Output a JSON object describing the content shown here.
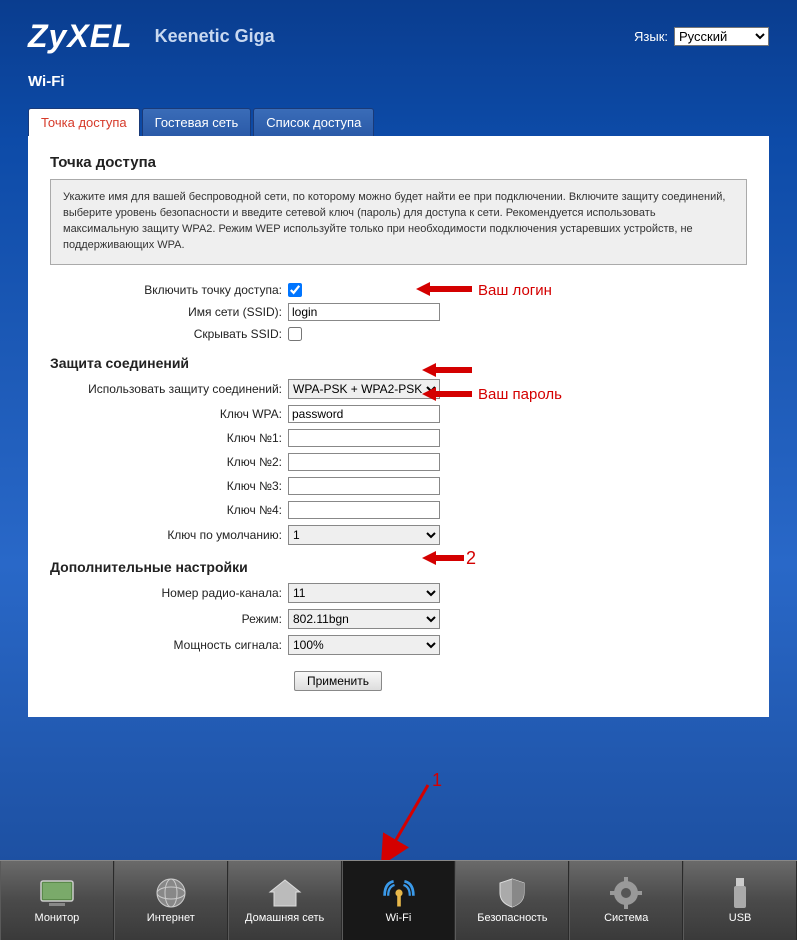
{
  "header": {
    "logo": "ZyXEL",
    "product": "Keenetic Giga",
    "lang_label": "Язык:",
    "lang_value": "Русский"
  },
  "page_title": "Wi-Fi",
  "tabs": [
    {
      "label": "Точка доступа",
      "active": true
    },
    {
      "label": "Гостевая сеть",
      "active": false
    },
    {
      "label": "Список доступа",
      "active": false
    }
  ],
  "main": {
    "heading": "Точка доступа",
    "help": "Укажите имя для вашей беспроводной сети, по которому можно будет найти ее при подключении. Включите защиту соединений, выберите уровень безопасности и введите сетевой ключ (пароль) для доступа к сети. Рекомендуется использовать максимальную защиту WPA2. Режим WEP используйте только при необходимости подключения устаревших устройств, не поддерживающих WPA."
  },
  "fields": {
    "enable_ap_label": "Включить точку доступа:",
    "ssid_label": "Имя сети (SSID):",
    "ssid_value": "login",
    "hide_ssid_label": "Скрывать SSID:"
  },
  "security": {
    "heading": "Защита соединений",
    "mode_label": "Использовать защиту соединений:",
    "mode_value": "WPA-PSK + WPA2-PSK",
    "wpa_key_label": "Ключ WPA:",
    "wpa_key_value": "password",
    "key1_label": "Ключ №1:",
    "key2_label": "Ключ №2:",
    "key3_label": "Ключ №3:",
    "key4_label": "Ключ №4:",
    "default_key_label": "Ключ по умолчанию:",
    "default_key_value": "1"
  },
  "advanced": {
    "heading": "Дополнительные настройки",
    "channel_label": "Номер радио-канала:",
    "channel_value": "11",
    "mode_label": "Режим:",
    "mode_value": "802.11bgn",
    "power_label": "Мощность сигнала:",
    "power_value": "100%"
  },
  "apply_label": "Применить",
  "annotations": {
    "login_note": "Ваш логин",
    "password_note": "Ваш пароль",
    "number_1": "1",
    "number_2": "2"
  },
  "bottom_nav": [
    {
      "label": "Монитор",
      "icon": "monitor-icon"
    },
    {
      "label": "Интернет",
      "icon": "globe-icon"
    },
    {
      "label": "Домашняя сеть",
      "icon": "home-icon"
    },
    {
      "label": "Wi-Fi",
      "icon": "wifi-icon",
      "active": true
    },
    {
      "label": "Безопасность",
      "icon": "shield-icon"
    },
    {
      "label": "Система",
      "icon": "gear-icon"
    },
    {
      "label": "USB",
      "icon": "usb-icon"
    }
  ]
}
